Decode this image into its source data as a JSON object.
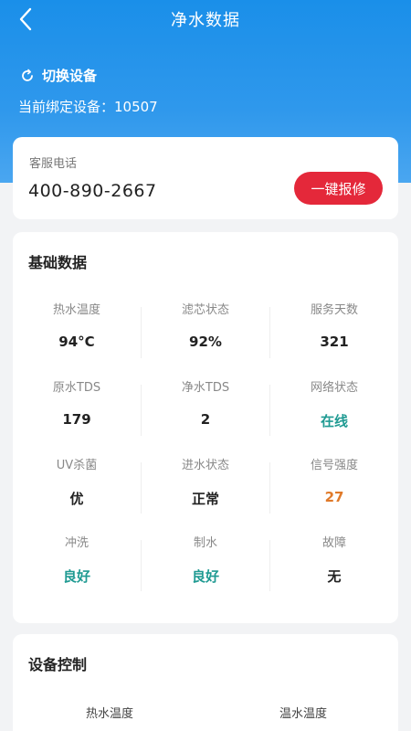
{
  "header": {
    "title": "净水数据",
    "switch_label": "切换设备",
    "bound_device": "当前绑定设备：10507"
  },
  "service": {
    "label": "客服电话",
    "phone": "400-890-2667",
    "repair_button": "一键报修"
  },
  "basic": {
    "title": "基础数据",
    "items": [
      {
        "name": "热水温度",
        "value": "94°C",
        "color": "#222222"
      },
      {
        "name": "滤芯状态",
        "value": "92%",
        "color": "#222222"
      },
      {
        "name": "服务天数",
        "value": "321",
        "color": "#222222"
      },
      {
        "name": "原水TDS",
        "value": "179",
        "color": "#222222"
      },
      {
        "name": "净水TDS",
        "value": "2",
        "color": "#222222"
      },
      {
        "name": "网络状态",
        "value": "在线",
        "color": "#1f9a92"
      },
      {
        "name": "UV杀菌",
        "value": "优",
        "color": "#222222"
      },
      {
        "name": "进水状态",
        "value": "正常",
        "color": "#222222"
      },
      {
        "name": "信号强度",
        "value": "27",
        "color": "#e07a2a"
      },
      {
        "name": "冲洗",
        "value": "良好",
        "color": "#1f9a92"
      },
      {
        "name": "制水",
        "value": "良好",
        "color": "#1f9a92"
      },
      {
        "name": "故障",
        "value": "无",
        "color": "#222222"
      }
    ]
  },
  "control": {
    "title": "设备控制",
    "hot_label": "热水温度",
    "warm_label": "温水温度"
  },
  "colors": {
    "accent": "#1a8fe9",
    "repair": "#e4283a",
    "good": "#1f9a92",
    "warning": "#e07a2a"
  },
  "icons": {
    "back": "chevron-left-icon",
    "switch": "refresh-icon"
  }
}
